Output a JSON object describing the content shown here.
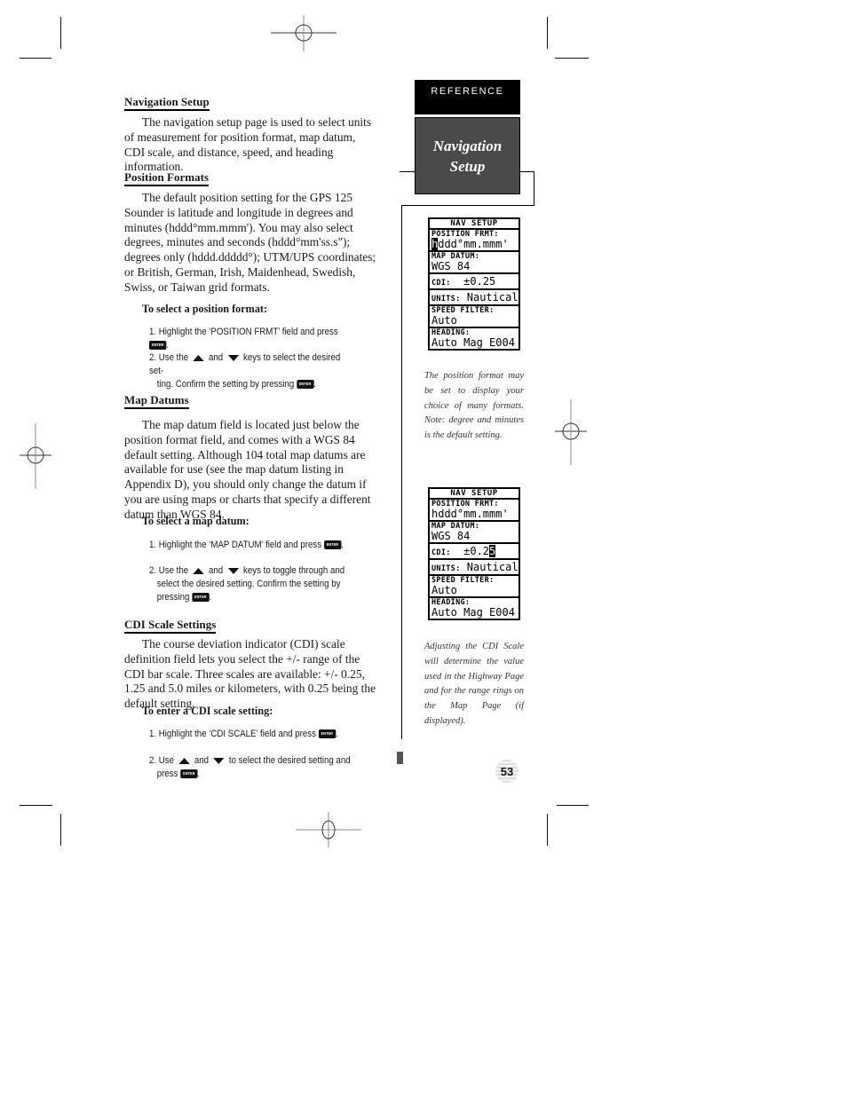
{
  "sections": {
    "navigation_setup": {
      "heading": "Navigation Setup",
      "body": "The navigation setup page is used to select units of measurement for position format, map datum, CDI scale, and distance, speed, and heading information."
    },
    "position_formats": {
      "heading": "Position Formats",
      "body": "The default position setting for the GPS 125 Sounder is latitude and longitude in degrees and minutes (hddd°mm.mmm'). You may also select degrees, minutes and seconds (hddd°mm'ss.s\"); degrees only (hddd.ddddd°); UTM/UPS coordinates; or British, German, Irish, Maidenhead, Swedish, Swiss, or Taiwan grid formats.",
      "procedure_title": "To select a position format:",
      "step1_text": "1. Highlight the ‘POSITION FRMT’ field and press",
      "step2_a": "2. Use the",
      "step2_and": "and",
      "step2_b": "keys to select the desired set-",
      "step2_c": "ting. Confirm the setting by pressing"
    },
    "map_datums": {
      "heading": "Map Datums",
      "body": "The map datum field is located just below the position format field, and comes with a WGS 84 default setting. Although 104 total map datums are available for use (see the map datum listing in Appendix D), you should only change the datum if you are using maps or charts that specify a different datum than WGS 84.",
      "procedure_title": "To select a map datum:",
      "step1_text": "1. Highlight the ‘MAP DATUM’ field and press",
      "step2_a": "2. Use the",
      "step2_and": "and",
      "step2_b": "keys to toggle through and",
      "step2_c": "select the desired setting. Confirm the setting by",
      "step2_d": "pressing"
    },
    "cdi_scale": {
      "heading": "CDI Scale Settings",
      "body": "The course deviation indicator (CDI) scale definition field lets you select the +/- range of the CDI bar scale. Three scales are available: +/- 0.25, 1.25 and 5.0 miles or kilometers, with 0.25 being the default setting.",
      "procedure_title": "To enter a CDI scale setting:",
      "step1_text": "1. Highlight the ‘CDI SCALE’ field and press",
      "step2_a": "2. Use",
      "step2_and": "and",
      "step2_b": "to select the desired setting and",
      "step2_c": "press"
    }
  },
  "keys": {
    "enter_label": "ENTER",
    "up_icon": "up-arrow-key",
    "down_icon": "down-arrow-key"
  },
  "sidebar": {
    "tab_label": "REFERENCE",
    "title_line1": "Navigation",
    "title_line2": "Setup"
  },
  "screens": [
    {
      "header": "NAV SETUP",
      "position_label": "POSITION FRMT:",
      "position_cursor": "h",
      "position_value": "ddd°mm.mmm'",
      "datum_label": "MAP DATUM:",
      "datum_value": "WGS 84",
      "cdi_label": "CDI:",
      "cdi_value": "±0.25",
      "cdi_cursor": "",
      "units_label": "UNITS:",
      "units_value": "Nautical",
      "speed_label": "SPEED FILTER:",
      "speed_value": "Auto",
      "heading_label": "HEADING:",
      "heading_value": "Auto Mag E004"
    },
    {
      "header": "NAV SETUP",
      "position_label": "POSITION FRMT:",
      "position_cursor": "",
      "position_value": "hddd°mm.mmm'",
      "datum_label": "MAP DATUM:",
      "datum_value": "WGS 84",
      "cdi_label": "CDI:",
      "cdi_value": "±0.2",
      "cdi_cursor": "5",
      "units_label": "UNITS:",
      "units_value": "Nautical",
      "speed_label": "SPEED FILTER:",
      "speed_value": "Auto",
      "heading_label": "HEADING:",
      "heading_value": "Auto Mag E004"
    }
  ],
  "captions": [
    "The position format may be set to display your choice of many formats. Note: degree and minutes is the default setting.",
    "Adjusting the CDI Scale will determine the value used in the Highway Page and for the range rings on the Map Page (if displayed)."
  ],
  "page_number": "53"
}
